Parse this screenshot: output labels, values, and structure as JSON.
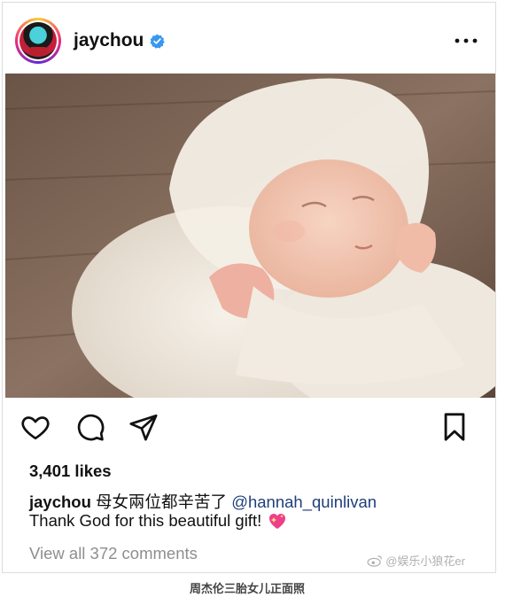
{
  "post": {
    "username": "jaychou",
    "verified": true,
    "likes": "3,401 likes",
    "caption_username": "jaychou",
    "caption_text": " 母女兩位都辛苦了 ",
    "caption_mention": "@hannah_quinlivan",
    "caption_line2": "Thank God for this beautiful gift!",
    "view_comments": "View all 372 comments"
  },
  "watermark": "@娱乐小狼花er",
  "footer_caption": "周杰伦三胎女儿正面照",
  "colors": {
    "verified": "#3897f0",
    "mention": "#1f3f7a",
    "muted": "#8e8e8e"
  }
}
